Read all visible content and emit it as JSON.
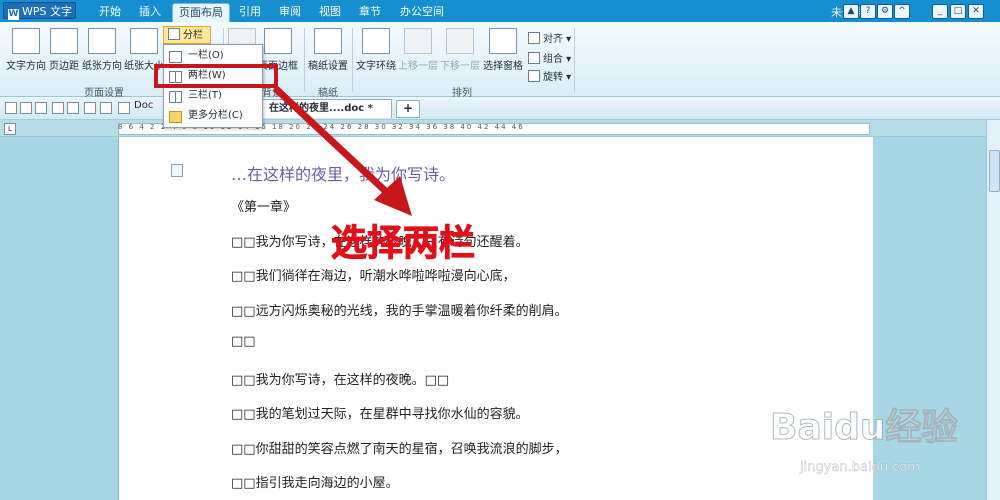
{
  "app": {
    "title": "WPS 文字",
    "logo_letter": "W",
    "login": "未登录"
  },
  "menu_tabs": [
    "开始",
    "插入",
    "页面布局",
    "引用",
    "审阅",
    "视图",
    "章节",
    "办公空间"
  ],
  "ribbon": {
    "buttons": [
      "文字方向",
      "页边距",
      "纸张方向",
      "纸张大小",
      "页面边框",
      "稿纸设置",
      "文字环绕",
      "上移一层",
      "下移一层",
      "选择窗格"
    ],
    "fenlan": "分栏",
    "align": [
      "对齐",
      "组合",
      "旋转"
    ],
    "group_labels": {
      "page_setup": "页面设置",
      "background": "背景",
      "manuscript": "稿纸",
      "arrange": "排列"
    }
  },
  "dropdown": {
    "items": [
      "一栏(O)",
      "两栏(W)",
      "三栏(T)",
      "更多分栏(C)"
    ],
    "highlighted_index": 1
  },
  "tabs": {
    "inactive": "Doc",
    "active": "在这样的夜里....doc *",
    "add": "+"
  },
  "ruler": {
    "ticks": "8 6 4 2 2 4 6 8 10 12 14 16 18 20 22 24 26 28 30 32 34 36 38 40 42 44 46"
  },
  "document": {
    "lines": [
      "…在这样的夜里，我为你写诗。",
      "《第一章》",
      "□□我为你写诗，在这样的夜晚，只有诗句还醒着。",
      "□□我们徜徉在海边，听潮水哗啦哗啦漫向心底，",
      "□□远方闪烁奥秘的光线，我的手掌温暖着你纤柔的削肩。",
      "□□",
      "□□我为你写诗，在这样的夜晚。□□",
      "□□我的笔划过天际，在星群中寻找你水仙的容貌。",
      "□□你甜甜的笑容点燃了南天的星宿，召唤我流浪的脚步，",
      "□□指引我走向海边的小屋。"
    ]
  },
  "annotation": "选择两栏",
  "watermark": {
    "logo": "Baidu经验",
    "url": "jingyan.baidu.com"
  },
  "colors": {
    "title_bar": "#168fd0",
    "highlight": "#c8161d",
    "annotation": "#e0101b"
  }
}
